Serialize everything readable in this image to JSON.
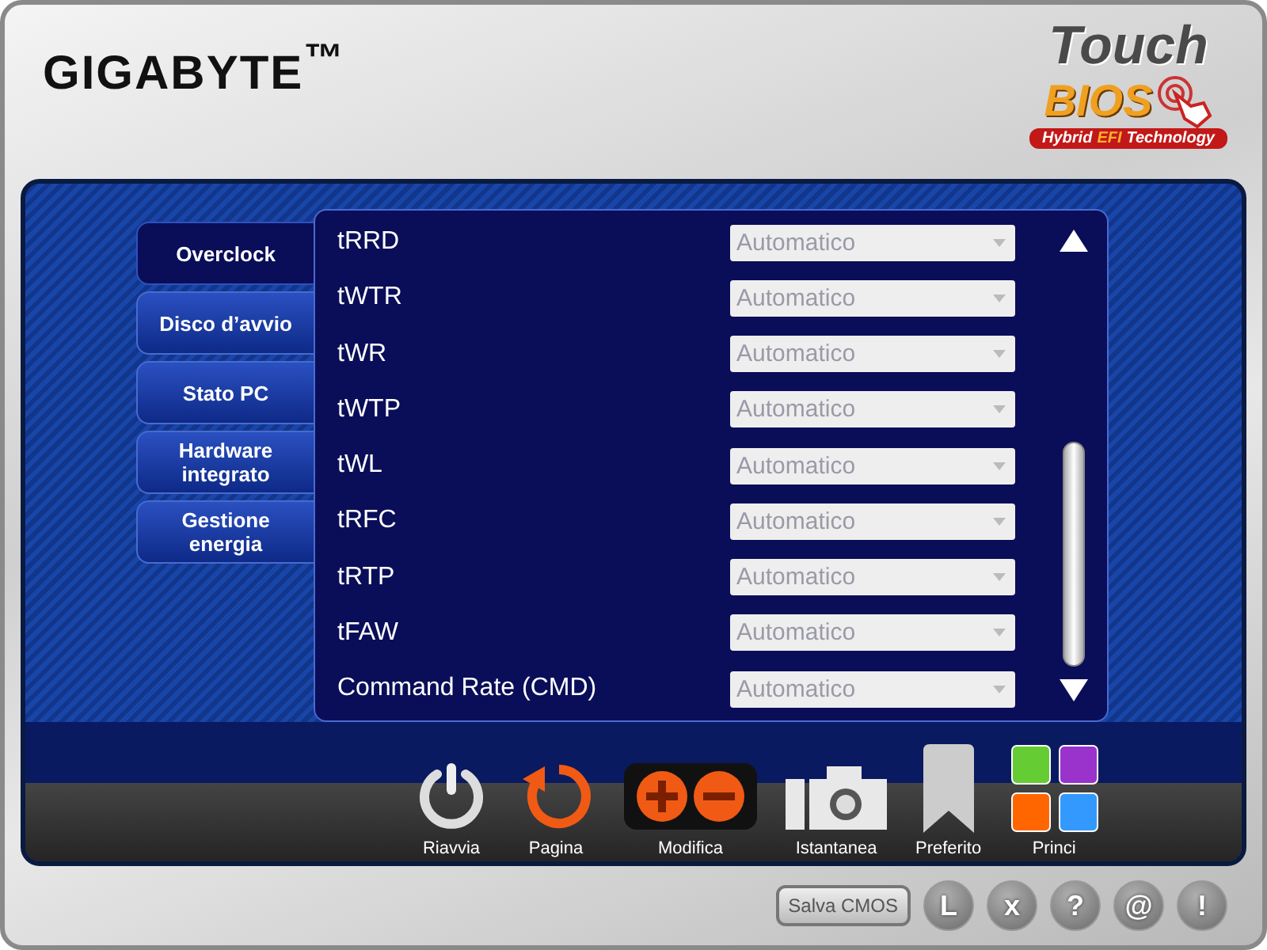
{
  "header": {
    "brand": "GIGABYTE$^{™}$",
    "logo": {
      "line_1": "Touch",
      "line_2": "BIOS",
      "tagline": [
        "Hybrid",
        "EFI",
        "Technology"
      ]
    }
  },
  "tabs": [
    {
      "label": "Overclock",
      "selected": true
    },
    {
      "label": "Disco d’avvio",
      "selected": false
    },
    {
      "label": "Stato PC",
      "selected": false
    },
    {
      "label": "Hardware integrato",
      "selected": false
    },
    {
      "label": "Gestione energia",
      "selected": false
    }
  ],
  "settings": [
    {
      "name": "tRRD",
      "value": "Automatico"
    },
    {
      "name": "tWTR",
      "value": "Automatico"
    },
    {
      "name": "tWR",
      "value": "Automatico"
    },
    {
      "name": "tWTP",
      "value": "Automatico"
    },
    {
      "name": "tWL",
      "value": "Automatico"
    },
    {
      "name": "tRFC",
      "value": "Automatico"
    },
    {
      "name": "tRTP",
      "value": "Automatico"
    },
    {
      "name": "tFAW",
      "value": "Automatico"
    },
    {
      "name": "Command Rate (CMD)",
      "value": "Automatico"
    }
  ],
  "toolbar": [
    {
      "kind": "power",
      "label": "Riavvia"
    },
    {
      "kind": "refresh",
      "label": "Pagina"
    },
    {
      "kind": "plusminus",
      "label": "Modifica"
    },
    {
      "kind": "camera",
      "label": "Istantanea"
    },
    {
      "kind": "bookmark",
      "label": "Preferito"
    },
    {
      "kind": "tiles",
      "label": "Princi"
    }
  ],
  "footer": {
    "save_button": "Salva CMOS",
    "round_buttons": [
      "L",
      "x",
      "?",
      "@",
      "!"
    ]
  }
}
